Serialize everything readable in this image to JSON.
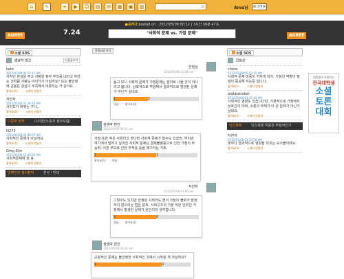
{
  "topbar": {
    "user": "Ares님",
    "logout_label": "로그아웃",
    "search_placeholder": ""
  },
  "infobar": {
    "brand": "●프리다",
    "posted": "posted on : 2012/05/08 00:12 | 3시간 36분 47초"
  },
  "header": {
    "left_label": "AGREE",
    "right_label": "AGREE",
    "left_score": "7.24",
    "right_score": "5",
    "topic": "\"사회적 문제 vs. 가정 문제\""
  },
  "left": {
    "tab_label": "소셜 SOS",
    "entries": [
      {
        "name": "샘날박 변진",
        "tag": "다음글쓰기",
        "date": "",
        "text": "",
        "show_actions": false
      },
      {
        "name": "kate",
        "date": "2012/05/08 05:51:12 AM",
        "text": "사적인 관심을 주고 사랑을 줘야 무리를 내리고 자라는 것처럼 사랑도 아이가기 아닐까요? 또는 불안정에 곤봉은 관심이 부족해서 비롯되는 거 같아요.",
        "actions": [
          "좋아요(1)",
          "소셜지 만들기"
        ],
        "show_actions": true
      },
      {
        "name": "자한자",
        "date": "2012/05/08 01:36:43 AM",
        "text": "사이드가 바뀌는 구나..",
        "actions": [
          "좋아요(2)",
          "소셜지 만들기"
        ],
        "show_actions": true
      }
    ],
    "bar1": {
      "title": "다문화 정책",
      "sub": "(10대인노동자 정부포럼)"
    },
    "entries2": [
      {
        "name": "lil273",
        "date": "2012/05/08 01:00:07 AM",
        "text": "사회적인 문제가 아닐까요",
        "actions": [
          "좋아요(1)",
          "소셜지 만들기"
        ],
        "show_actions": true
      },
      {
        "name": "Greg Kim",
        "date": "2012/05/08 12:46:50 AM",
        "text": "사회적문제에 한 표",
        "actions": [
          "좋아요(1)",
          "소셜지 만들기"
        ],
        "show_actions": true
      }
    ],
    "bar2": {
      "title": "연예인의 정치참여",
      "sub": "찬성 / 반대"
    }
  },
  "center": {
    "viewall": "응용답글 보기",
    "cards": [
      {
        "author": "한빌상",
        "date": "2012/05/08 01:08 am",
        "text": "돕고 보니 사회적 문제가 가정문제는 밀처로 나올 것이 아니라고 봅니다. 상호적으로 작용해서 결과적으로 발생된 문제가 아닌가 싶네요.",
        "a": "1",
        "b": "3",
        "like": "좋아요(0)",
        "reply": "댓글"
      },
      {
        "author": "샘샘박 변진",
        "date": "2012/05/08 06:41 am",
        "text": "가정 또한 작은 사회라고 한다면 사회적 문제가 될수도 있겠죠. 하지만 여기에서 말하고 싶어진 사회적 문제는 경제불평등으로 인한 가정의 무능력, 이혼 부모로 인한 부적응 등을 얘기하는 거죠.",
        "a": "2",
        "b": "1",
        "like": "좋아요(1)",
        "reply": "댓글"
      },
      {
        "author": "자한자",
        "date": "2012/05/08 01:06 am",
        "text": "그렇수도 있지만 안정된 사회라도 현서 가정의 불화가 발생하지 않으리는 법은 없죠. 사회구조의 가장 작은 단위인 가정에서 발생한 문제가 원인이라 생각합니다.",
        "a": "0",
        "b": "0",
        "like": "좋아요(2)",
        "reply": "댓글"
      },
      {
        "author": "샘샘박 변진",
        "date": "2012/05/08 04:22 am",
        "text": "근본적인 문제는 불안정한 사회적인 것에서 시작된 게 아닐까요?",
        "a": "1",
        "b": "0",
        "like": "좋아요(1)",
        "reply": "댓글"
      }
    ]
  },
  "right": {
    "tab_label": "소셜 SOS",
    "entries": [
      {
        "name": "한빌상",
        "date": "",
        "text": "",
        "show_actions": false
      },
      {
        "name": "choos",
        "date": "2012/05/08 05:53:15 AM",
        "text": "사회적 문제 비중이 커지게 되어. 가정의 역할이 점점이 중요해 지는듯 합니다.",
        "actions": [
          "좋아요(1)",
          "소셜지 만들기"
        ],
        "show_actions": true
      },
      {
        "name": "aldhbatrobel",
        "date": "2012/05/08 03:37:44 AM",
        "text": "사회적인 영향도 있습니다만, 기본적으로 가정에서 상호간의 대화, 소통의 부재가 더 큰 문제가 아닌가 싶네요.",
        "actions": [
          "좋아요(1)",
          "소셜지 만들기"
        ],
        "show_actions": true
      }
    ],
    "bar1": {
      "title": "인간복제",
      "sub": "인간복제 허용은 부정적인가"
    },
    "entries2": [
      {
        "name": "자한자",
        "date": "2012/05/08 01:10:56 AM",
        "text": "맞무다 결과적으로 영향을 미치는 요소들이네요.",
        "actions": [
          "좋아요(1)",
          "소셜지 만들기"
        ],
        "show_actions": true
      }
    ]
  },
  "side_banner": {
    "line1": "대학생의 주관하는",
    "line2": "전국대학생",
    "line3": "소셜",
    "line4": "토론",
    "line5": "대회"
  }
}
